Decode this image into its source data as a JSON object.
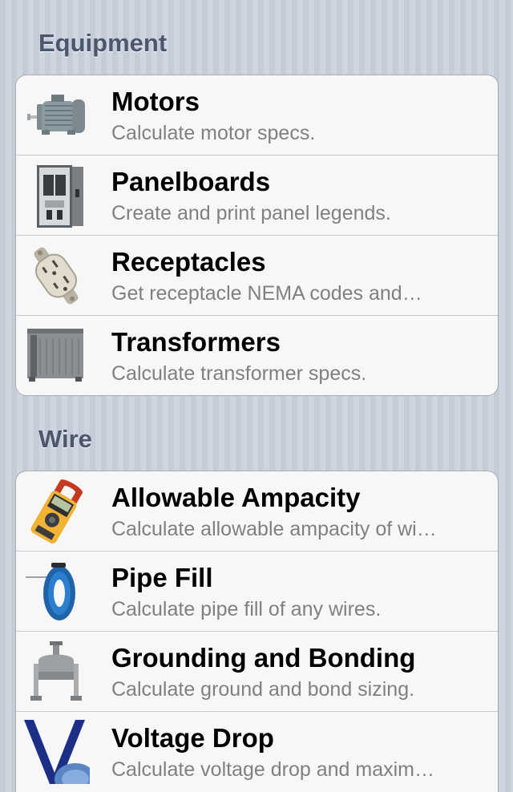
{
  "sections": [
    {
      "header": "Equipment",
      "items": [
        {
          "title": "Motors",
          "subtitle": "Calculate motor specs.",
          "icon": "motor-icon"
        },
        {
          "title": "Panelboards",
          "subtitle": "Create and print panel legends.",
          "icon": "panelboard-icon"
        },
        {
          "title": "Receptacles",
          "subtitle": "Get receptacle NEMA codes and…",
          "icon": "receptacle-icon"
        },
        {
          "title": "Transformers",
          "subtitle": "Calculate transformer specs.",
          "icon": "transformer-icon"
        }
      ]
    },
    {
      "header": "Wire",
      "items": [
        {
          "title": "Allowable Ampacity",
          "subtitle": "Calculate allowable ampacity of wi…",
          "icon": "clamp-meter-icon"
        },
        {
          "title": "Pipe Fill",
          "subtitle": "Calculate pipe fill of any wires.",
          "icon": "fish-tape-icon"
        },
        {
          "title": "Grounding and Bonding",
          "subtitle": "Calculate ground and bond sizing.",
          "icon": "ground-clamp-icon"
        },
        {
          "title": "Voltage Drop",
          "subtitle": "Calculate voltage drop and maxim…",
          "icon": "voltage-drop-icon"
        }
      ]
    }
  ]
}
